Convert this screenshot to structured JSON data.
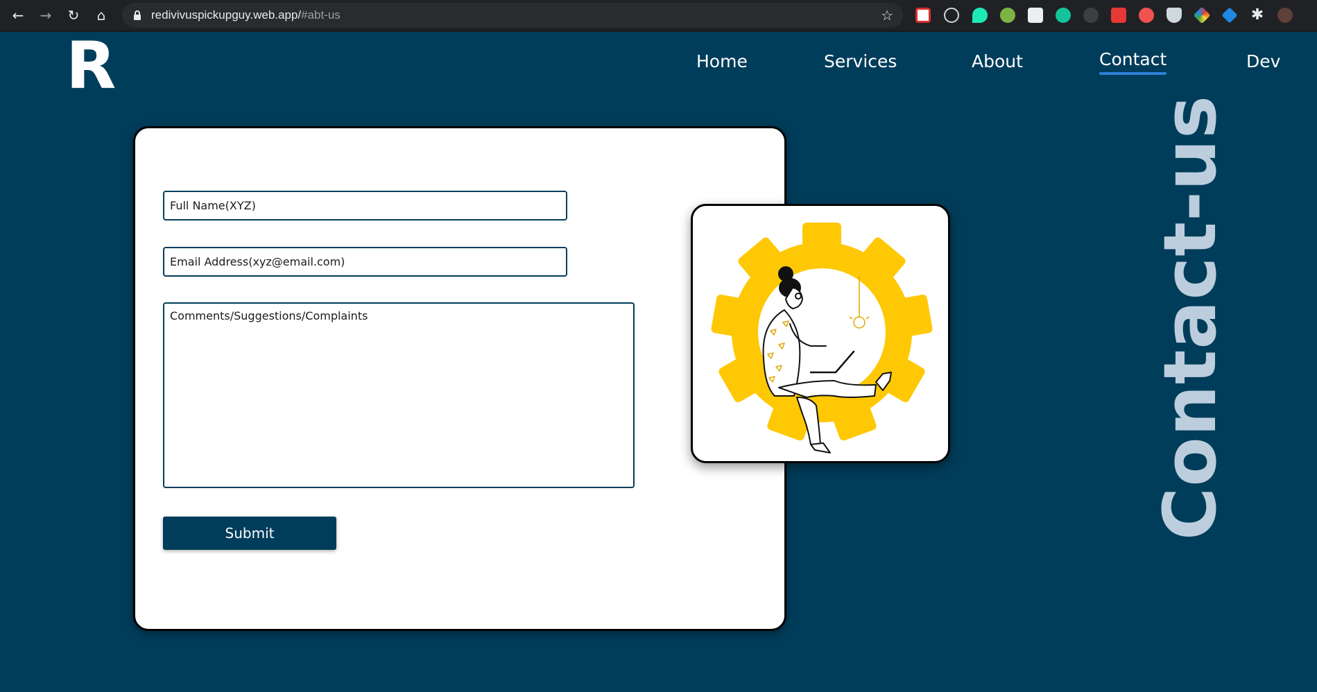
{
  "browser": {
    "url_host": "redivivuspickupguy.web.app/",
    "url_fragment": "#abt-us"
  },
  "logo": {
    "text": "R"
  },
  "nav": {
    "home": "Home",
    "services": "Services",
    "about": "About",
    "contact": "Contact",
    "dev": "Dev"
  },
  "section_title": "Contact-us",
  "form": {
    "name_placeholder": "Full Name(XYZ)",
    "email_placeholder": "Email Address(xyz@email.com)",
    "comments_placeholder": "Comments/Suggestions/Complaints",
    "submit_label": "Submit"
  },
  "colors": {
    "background": "#003d5a",
    "accent": "#2b7fd8",
    "gear_yellow": "#ffc805",
    "title_light": "#bccedd"
  }
}
